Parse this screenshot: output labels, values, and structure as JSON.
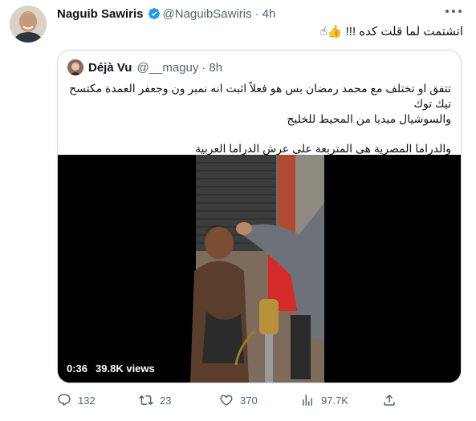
{
  "tweet": {
    "author_name": "Naguib Sawiris",
    "author_handle": "@NaguibSawiris",
    "separator": "·",
    "time": "4h",
    "text": "اتشتمت لما قلت كده !!! ",
    "emoji": "👍☝"
  },
  "quoted": {
    "author_name": "Déjà Vu",
    "author_handle": "@__maguy",
    "separator": "·",
    "time": "8h",
    "line1": "تتفق او تختلف مع محمد رمضان بس هو فعلاً اثبت انه نمبر ون وجعفر العمدة مكتسح تيك توك",
    "line2": "والسوشيال ميديا من المحيط للخليج",
    "line3": "والدراما المصرية هى المتربعة على عرش الدراما العربية",
    "video": {
      "duration": "0:36",
      "views": "39.8K views"
    }
  },
  "actions": {
    "replies": "132",
    "retweets": "23",
    "likes": "370",
    "views": "97.7K"
  },
  "colors": {
    "verified": "#1d9bf0",
    "muted": "#536471",
    "text": "#0f1419",
    "border": "#cfd9de"
  },
  "icons": [
    "verified-badge-icon",
    "more-icon",
    "reply-icon",
    "retweet-icon",
    "like-icon",
    "views-icon",
    "share-icon"
  ]
}
